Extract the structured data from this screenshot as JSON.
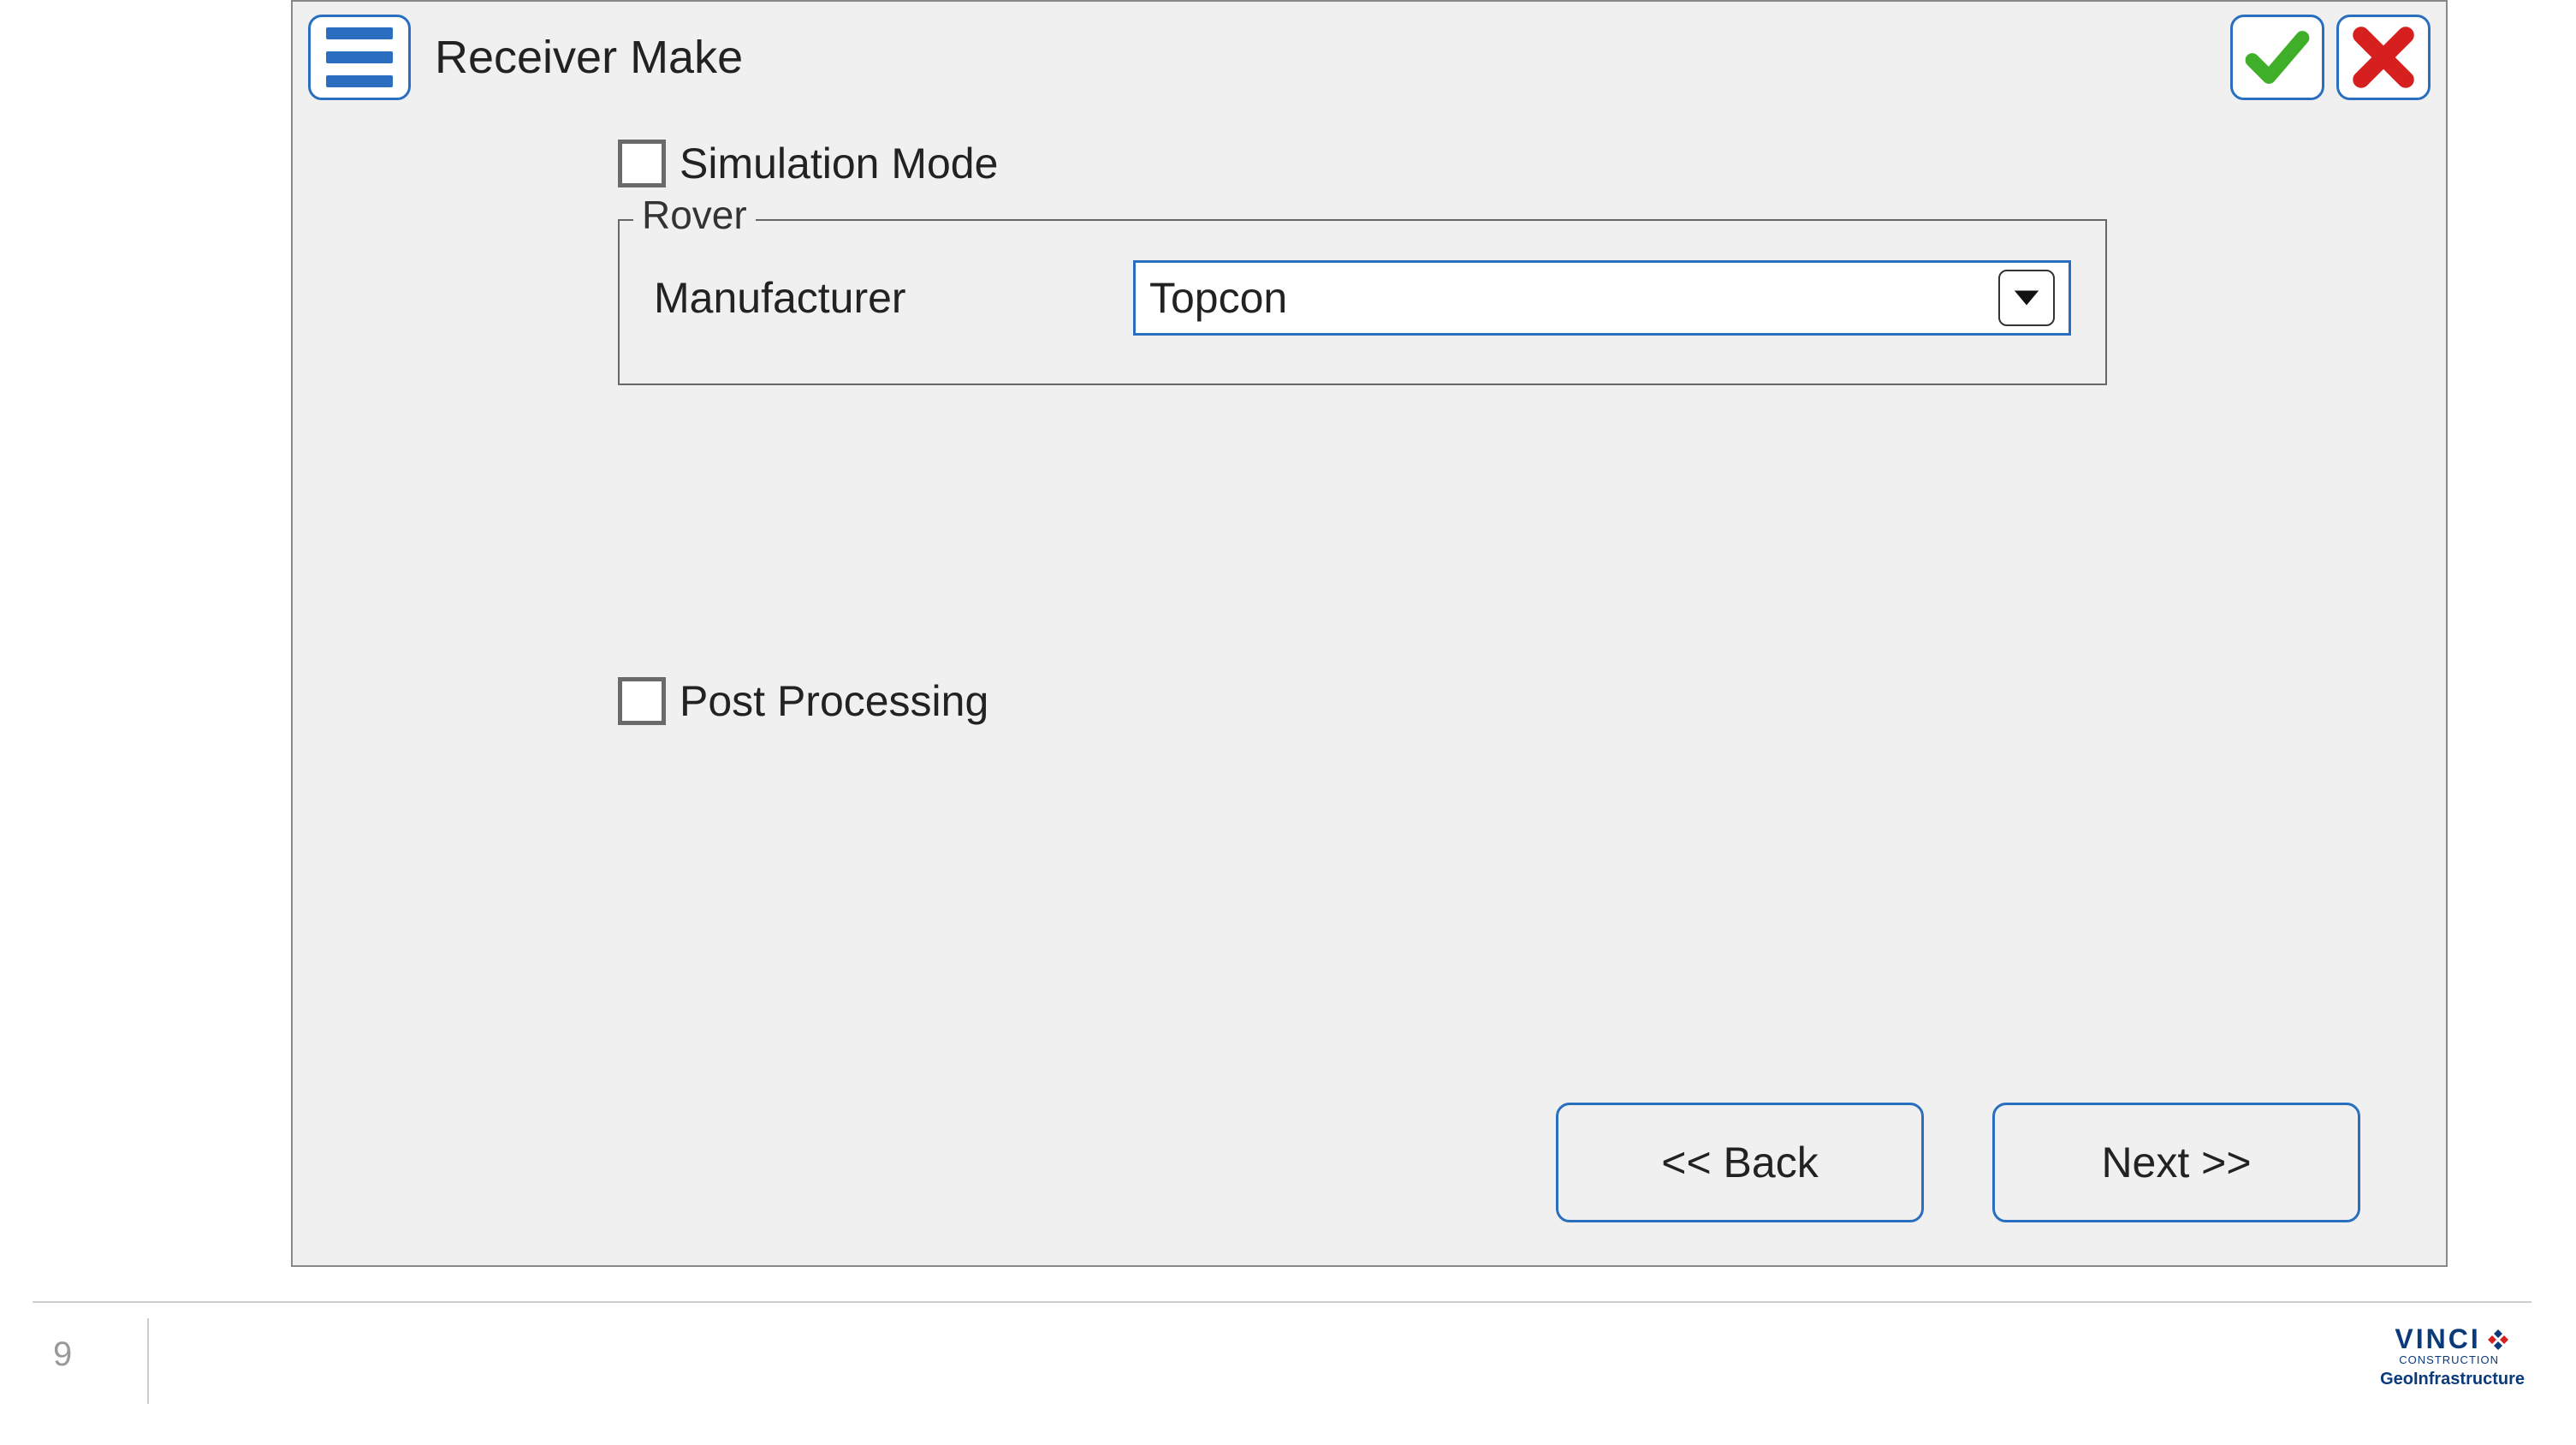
{
  "header": {
    "title": "Receiver Make"
  },
  "form": {
    "simulation_mode_label": "Simulation Mode",
    "rover": {
      "legend": "Rover",
      "manufacturer_label": "Manufacturer",
      "manufacturer_value": "Topcon"
    },
    "post_processing_label": "Post Processing"
  },
  "buttons": {
    "back": "<< Back",
    "next": "Next >>"
  },
  "footer": {
    "page_number": "9",
    "logo": {
      "brand": "VINCI",
      "line1": "CONSTRUCTION",
      "line2": "GeoInfrastructure"
    }
  }
}
